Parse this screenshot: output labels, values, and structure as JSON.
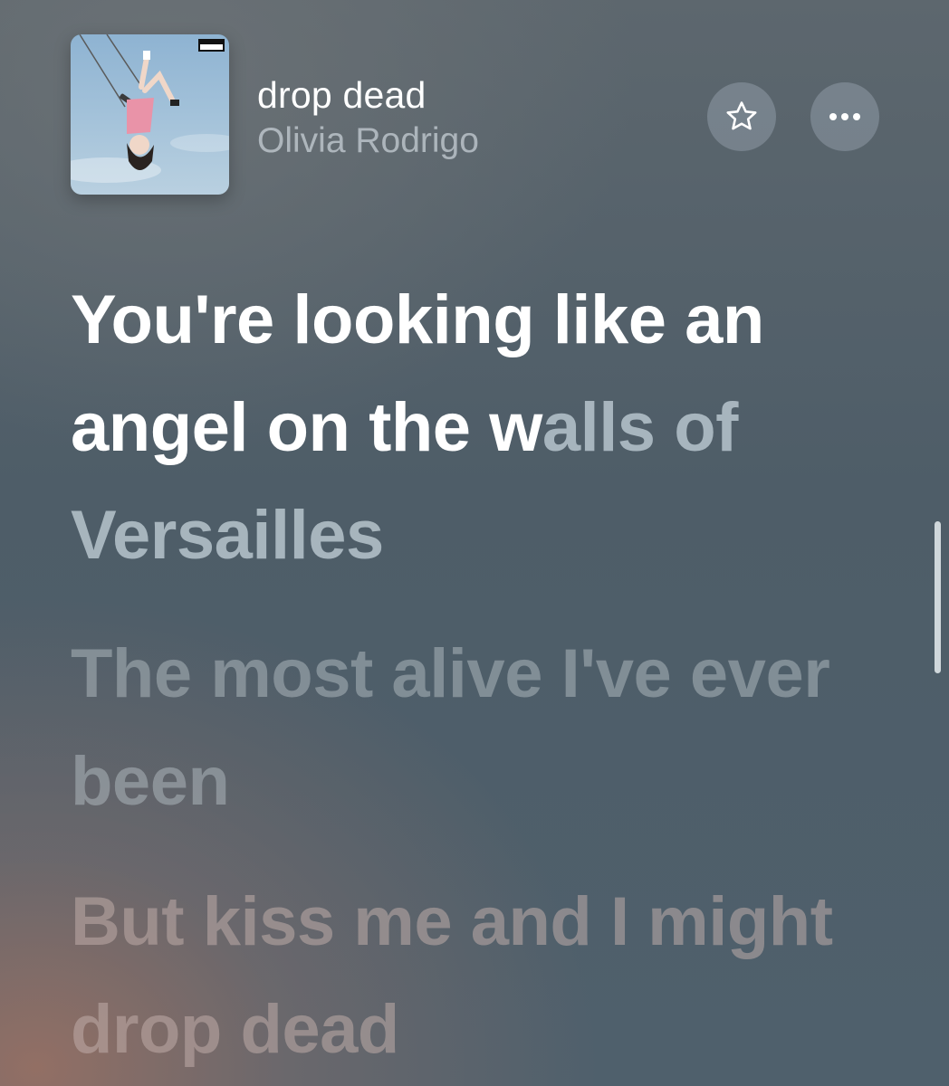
{
  "now_playing": {
    "title": "drop dead",
    "artist": "Olivia Rodrigo",
    "artwork_icon": "album-artwork-swing",
    "artwork_badge": "PARENTAL ADVISORY EXPLICIT CONTENT"
  },
  "actions": {
    "favorite_icon": "star-outline-icon",
    "more_icon": "ellipsis-icon"
  },
  "lyrics": {
    "active_line": {
      "sung": "You're looking like an angel on the w",
      "unsung": "alls of Versailles"
    },
    "upcoming_lines": [
      "The most alive I've ever been",
      "But kiss me and I might drop dead"
    ]
  },
  "colors": {
    "active_lyric": "#ffffff",
    "background_top": "#5d676e",
    "background_accent": "#967064"
  }
}
